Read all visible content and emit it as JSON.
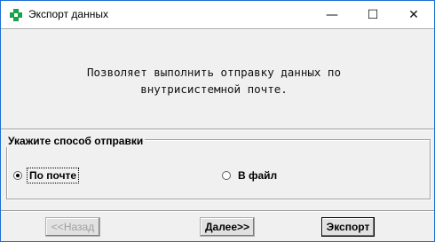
{
  "window": {
    "title": "Экспорт данных",
    "icon": "green-cross-icon",
    "controls": {
      "minimize": "—",
      "maximize": "☐",
      "close": "✕"
    }
  },
  "description": {
    "line1": "Позволяет выполнить отправку данных по",
    "line2": "внутрисистемной почте."
  },
  "delivery_group": {
    "title": "Укажите способ отправки",
    "options": [
      {
        "label": "По почте",
        "selected": true
      },
      {
        "label": "В файл",
        "selected": false
      }
    ]
  },
  "buttons": {
    "back": "<<Назад",
    "next": "Далее>>",
    "export": "Экспорт"
  },
  "colors": {
    "accent": "#1f6fd1",
    "icon_green": "#1aa34a"
  }
}
